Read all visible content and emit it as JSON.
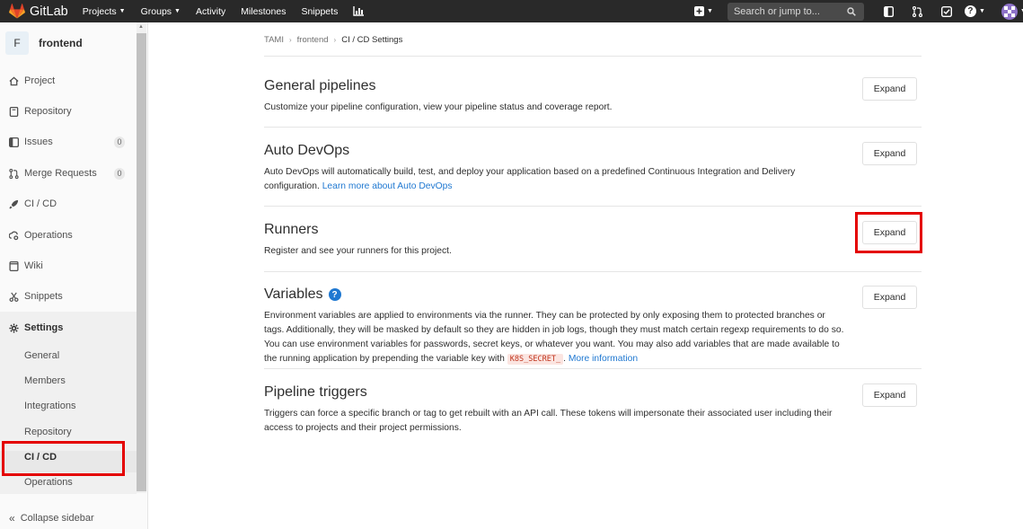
{
  "navbar": {
    "brand": "GitLab",
    "links": [
      {
        "label": "Projects",
        "dropdown": true
      },
      {
        "label": "Groups",
        "dropdown": true
      },
      {
        "label": "Activity",
        "dropdown": false
      },
      {
        "label": "Milestones",
        "dropdown": false
      },
      {
        "label": "Snippets",
        "dropdown": false
      }
    ],
    "search_placeholder": "Search or jump to...",
    "icons": [
      "plus-square-icon",
      "sidebar-icon",
      "merge-request-icon",
      "todo-check-icon",
      "help-icon",
      "avatar"
    ]
  },
  "sidebar": {
    "project_initial": "F",
    "project_name": "frontend",
    "items": [
      {
        "label": "Project",
        "icon": "home-icon"
      },
      {
        "label": "Repository",
        "icon": "book-icon"
      },
      {
        "label": "Issues",
        "icon": "issues-icon",
        "count": "0"
      },
      {
        "label": "Merge Requests",
        "icon": "merge-request-icon",
        "count": "0"
      },
      {
        "label": "CI / CD",
        "icon": "rocket-icon"
      },
      {
        "label": "Operations",
        "icon": "cloud-gear-icon"
      },
      {
        "label": "Wiki",
        "icon": "book-open-icon"
      },
      {
        "label": "Snippets",
        "icon": "scissors-icon"
      },
      {
        "label": "Settings",
        "icon": "gear-icon"
      }
    ],
    "settings_sub": [
      "General",
      "Members",
      "Integrations",
      "Repository",
      "CI / CD",
      "Operations"
    ],
    "collapse_label": "Collapse sidebar"
  },
  "breadcrumbs": [
    "TAMI",
    "frontend",
    "CI / CD Settings"
  ],
  "sections": [
    {
      "title": "General pipelines",
      "desc": "Customize your pipeline configuration, view your pipeline status and coverage report.",
      "button": "Expand"
    },
    {
      "title": "Auto DevOps",
      "desc": "Auto DevOps will automatically build, test, and deploy your application based on a predefined Continuous Integration and Delivery configuration.",
      "link": "Learn more about Auto DevOps",
      "button": "Expand"
    },
    {
      "title": "Runners",
      "desc": "Register and see your runners for this project.",
      "button": "Expand"
    },
    {
      "title": "Variables",
      "desc": "Environment variables are applied to environments via the runner. They can be protected by only exposing them to protected branches or tags. Additionally, they will be masked by default so they are hidden in job logs, though they must match certain regexp requirements to do so. You can use environment variables for passwords, secret keys, or whatever you want. You may also add variables that are made available to the running application by prepending the variable key with",
      "code": "K8S_SECRET_",
      "after_code": ".",
      "link": "More information",
      "button": "Expand"
    },
    {
      "title": "Pipeline triggers",
      "desc": "Triggers can force a specific branch or tag to get rebuilt with an API call. These tokens will impersonate their associated user including their access to projects and their project permissions.",
      "button": "Expand"
    }
  ],
  "colors": {
    "navbar": "#292929",
    "link": "#1f78d1",
    "highlight": "#e40000"
  }
}
